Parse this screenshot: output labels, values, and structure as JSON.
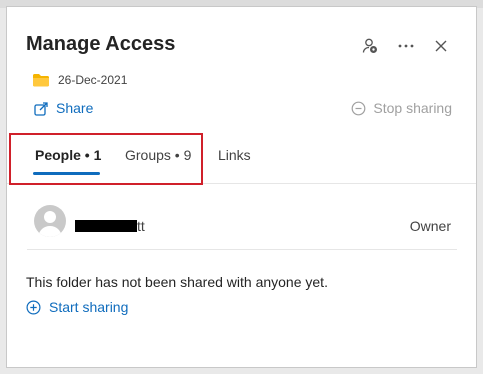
{
  "dialog": {
    "title": "Manage Access"
  },
  "item": {
    "folder_name": "26-Dec-2021"
  },
  "actions": {
    "share_label": "Share",
    "stop_sharing_label": "Stop sharing"
  },
  "tabs": [
    {
      "label": "People • 1",
      "active": true
    },
    {
      "label": "Groups • 9",
      "active": false
    },
    {
      "label": "Links",
      "active": false
    }
  ],
  "people": [
    {
      "name_visible_suffix": "tt",
      "role": "Owner"
    }
  ],
  "empty_state": {
    "message": "This folder has not been shared with anyone yet.",
    "start_sharing_label": "Start sharing"
  },
  "colors": {
    "accent": "#0f6cbd",
    "highlight": "#d0202a",
    "folder": "#f5b400",
    "disabled": "#a0a0a0"
  },
  "icons": {
    "header": [
      "manage-permissions-icon",
      "more-options-icon",
      "close-icon"
    ],
    "folder": "folder-icon",
    "share": "share-icon",
    "stop": "stop-sharing-icon",
    "add": "add-circle-icon",
    "avatar": "person-avatar-icon"
  }
}
